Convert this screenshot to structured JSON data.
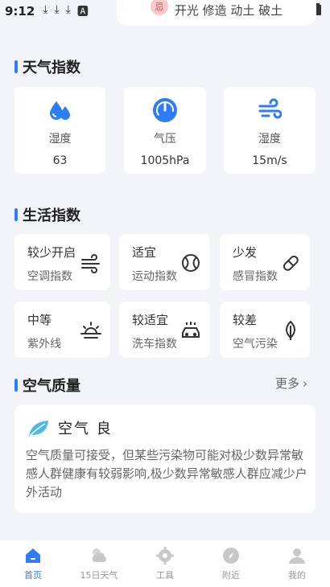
{
  "status_bar": {
    "time": "9:12"
  },
  "top_card": {
    "text": "开光 修造 动土 破土",
    "badge": "忌"
  },
  "weather_index": {
    "title": "天气指数",
    "items": [
      {
        "label": "湿度",
        "value": "63",
        "icon": "humidity-icon"
      },
      {
        "label": "气压",
        "value": "1005hPa",
        "icon": "pressure-gauge-icon"
      },
      {
        "label": "湿度",
        "value": "15m/s",
        "icon": "wind-icon"
      }
    ]
  },
  "life_index": {
    "title": "生活指数",
    "items": [
      {
        "value": "较少开启",
        "label": "空调指数",
        "icon": "air-conditioner-icon"
      },
      {
        "value": "适宜",
        "label": "运动指数",
        "icon": "ball-icon"
      },
      {
        "value": "少发",
        "label": "感冒指数",
        "icon": "pill-icon"
      },
      {
        "value": "中等",
        "label": "紫外线",
        "icon": "sunrise-icon"
      },
      {
        "value": "较适宜",
        "label": "洗车指数",
        "icon": "car-wash-icon"
      },
      {
        "value": "较差",
        "label": "空气污染",
        "icon": "leaf-drop-icon"
      }
    ]
  },
  "air_quality": {
    "title": "空气质量",
    "more": "更多",
    "status": "空气 良",
    "description": "空气质量可接受，但某些污染物可能对极少数异常敏感人群健康有较弱影响,极少数异常敏感人群应减少户外活动"
  },
  "bottom_nav": {
    "items": [
      {
        "label": "首页",
        "active": true
      },
      {
        "label": "15日天气",
        "active": false
      },
      {
        "label": "工具",
        "active": false
      },
      {
        "label": "附近",
        "active": false
      },
      {
        "label": "我的",
        "active": false
      }
    ]
  },
  "colors": {
    "accent": "#2f7df6",
    "background": "#f3f4f7",
    "leaf": "#4fb8ea"
  }
}
